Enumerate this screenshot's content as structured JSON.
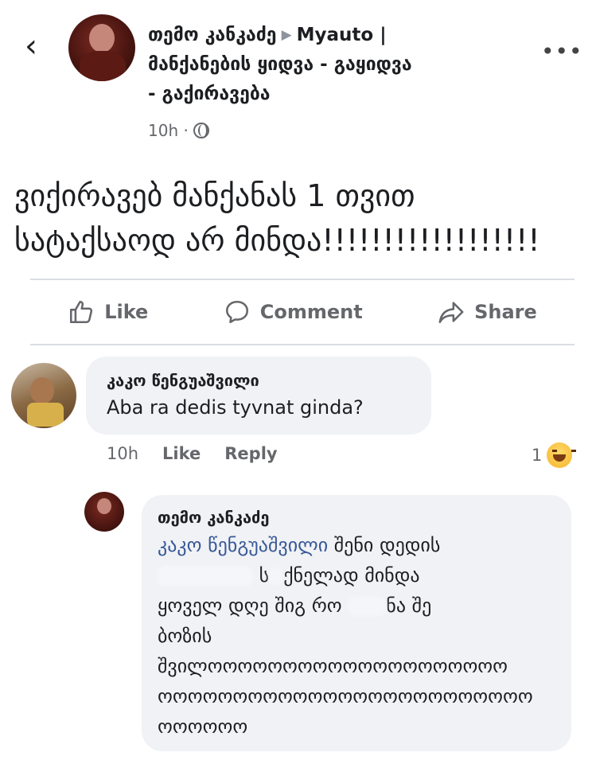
{
  "post": {
    "author": "თემო კანკაძე",
    "group_line1": "Myauto |",
    "group_line2": "მანქანების ყიდვა - გაყიდვა",
    "group_line3": "- გაქირავება",
    "time": "10h ·",
    "text_line1": "ვიქირავებ მანქანას 1 თვით",
    "text_line2": "სატაქსაოდ არ მინდა!!!!!!!!!!!!!!!!!!"
  },
  "actions": {
    "like": "Like",
    "comment": "Comment",
    "share": "Share"
  },
  "comment1": {
    "author": "კაკო წენგუაშვილი",
    "text": "Aba ra dedis tyvnat ginda?",
    "time": "10h",
    "like": "Like",
    "reply": "Reply",
    "reaction_count": "1",
    "reaction_icon": "haha-emoji-icon"
  },
  "comment2": {
    "author": "თემო კანკაძე",
    "mention": "კაკო წენგუაშვილი",
    "line1_rest": " შენი დედის",
    "line2_a": "ს",
    "line2_b": "ქნელად მინდა",
    "line3_a": "ყოველ დღე შიგ რო",
    "line3_b": "ნა შე",
    "line4": "ბოზის",
    "line5": "შვილოოოოოოოოოოოოოოოოოოოო",
    "line6": "ოოოოოოოოოოოოოოოოოოოოოოოოო",
    "line7": "ოოოოოო"
  },
  "colors": {
    "mention": "#385898",
    "bubble": "#f0f2f5",
    "meta": "#65676b"
  }
}
